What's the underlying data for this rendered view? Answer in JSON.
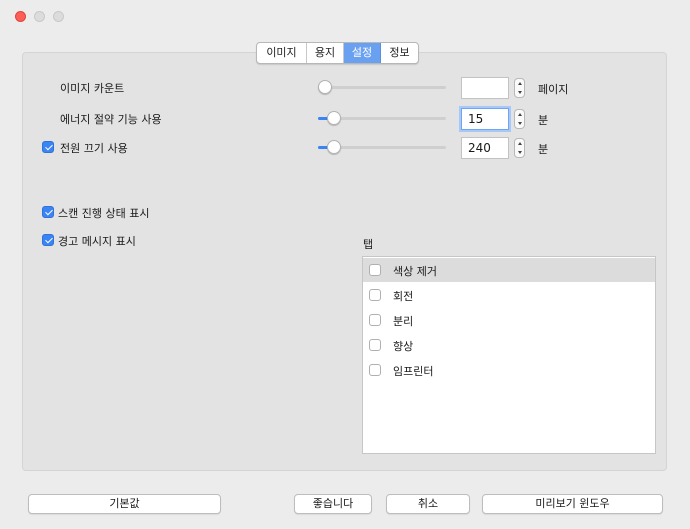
{
  "window": {
    "title": ""
  },
  "tabs": [
    {
      "label": "이미지",
      "active": false
    },
    {
      "label": "용지",
      "active": false
    },
    {
      "label": "설정",
      "active": true
    },
    {
      "label": "정보",
      "active": false
    }
  ],
  "settings": {
    "image_count": {
      "label": "이미지 카운트",
      "value": "",
      "unit": "페이지",
      "slider_fraction": 0.0
    },
    "energy_saving": {
      "label": "에너지 절약 기능 사용",
      "value": "15",
      "unit": "분",
      "slider_fraction": 0.08
    },
    "power_off": {
      "label": "전원 끄기 사용",
      "checked": true,
      "value": "240",
      "unit": "분",
      "slider_fraction": 0.08
    }
  },
  "options": {
    "scan_progress": {
      "label": "스캔 진행 상태 표시",
      "checked": true
    },
    "warning_message": {
      "label": "경고 메시지 표시",
      "checked": true
    }
  },
  "tab_list": {
    "title": "탭",
    "items": [
      {
        "label": "색상 제거",
        "checked": false,
        "selected": true
      },
      {
        "label": "회전",
        "checked": false,
        "selected": false
      },
      {
        "label": "분리",
        "checked": false,
        "selected": false
      },
      {
        "label": "향상",
        "checked": false,
        "selected": false
      },
      {
        "label": "임프린터",
        "checked": false,
        "selected": false
      }
    ]
  },
  "buttons": {
    "defaults": "기본값",
    "ok": "좋습니다",
    "cancel": "취소",
    "preview": "미리보기 윈도우"
  },
  "colors": {
    "accent": "#3b84f4",
    "tab_active": "#6aa0f0",
    "close_light": "#fc5f57"
  }
}
